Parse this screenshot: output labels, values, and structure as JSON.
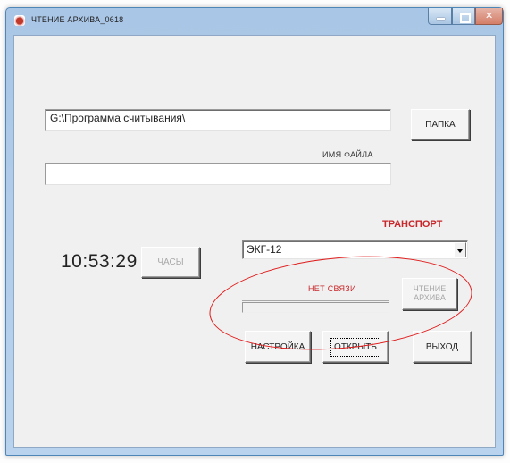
{
  "window": {
    "title": "ЧТЕНИЕ АРХИВА_0618",
    "icon": "app-icon"
  },
  "path_input": {
    "value": "G:\\Программа считывания\\"
  },
  "folder_button": {
    "label": "ПАПКА"
  },
  "filename_label": "ИМЯ ФАЙЛА",
  "filename_input": {
    "value": ""
  },
  "transport_label": "ТРАНСПОРТ",
  "clock": {
    "time": "10:53:29"
  },
  "clock_button": {
    "label": "ЧАСЫ",
    "enabled": false
  },
  "transport_select": {
    "selected": "ЭКГ-12"
  },
  "connection_status": "НЕТ СВЯЗИ",
  "read_archive_button": {
    "label": "ЧТЕНИЕ АРХИВА",
    "enabled": false
  },
  "progress": {
    "value": 0
  },
  "buttons": {
    "settings": "НАСТРОЙКА",
    "open": "ОТКРЫТЬ",
    "exit": "ВЫХОД"
  },
  "colors": {
    "accent_red": "#c8262a",
    "annotation_red": "#e01c1c"
  }
}
